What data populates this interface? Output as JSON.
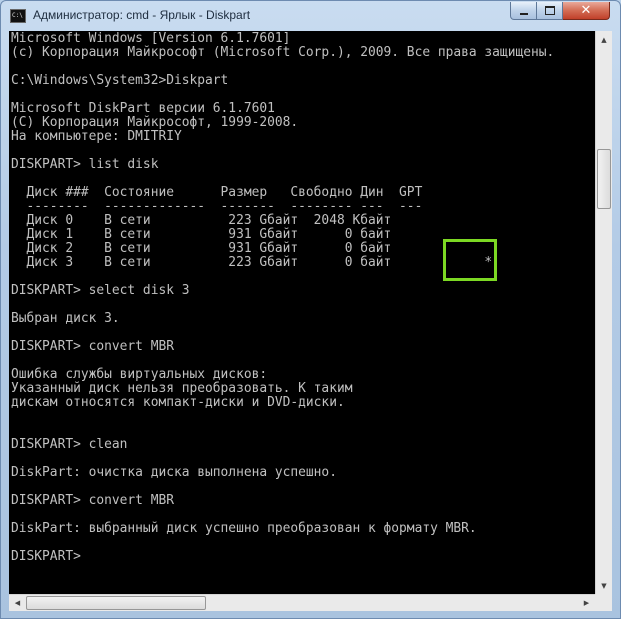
{
  "window": {
    "title": "Администратор: cmd - Ярлык - Diskpart",
    "icon_text": "C:\\",
    "controls": {
      "minimize": "minimize-icon",
      "maximize": "maximize-icon",
      "close": "close-icon"
    }
  },
  "console": {
    "lines": [
      "Microsoft Windows [Version 6.1.7601]",
      "(c) Корпорация Майкрософт (Microsoft Corp.), 2009. Все права защищены.",
      "",
      "C:\\Windows\\System32>Diskpart",
      "",
      "Microsoft DiskPart версии 6.1.7601",
      "(C) Корпорация Майкрософт, 1999-2008.",
      "На компьютере: DMITRIY",
      "",
      "DISKPART> list disk",
      "",
      "  Диск ###  Состояние      Размер   Свободно Дин  GPT",
      "  --------  -------------  -------  -------- ---  ---",
      "  Диск 0    В сети          223 Gбайт  2048 Kбайт",
      "  Диск 1    В сети          931 Gбайт      0 байт",
      "  Диск 2    В сети          931 Gбайт      0 байт",
      "  Диск 3    В сети          223 Gбайт      0 байт            *",
      "",
      "DISKPART> select disk 3",
      "",
      "Выбран диск 3.",
      "",
      "DISKPART> convert MBR",
      "",
      "Ошибка службы виртуальных дисков:",
      "Указанный диск нельзя преобразовать. К таким",
      "дискам относятся компакт-диски и DVD-диски.",
      "",
      "",
      "DISKPART> clean",
      "",
      "DiskPart: очистка диска выполнена успешно.",
      "",
      "DISKPART> convert MBR",
      "",
      "DiskPart: выбранный диск успешно преобразован к формату MBR.",
      "",
      "DISKPART>"
    ]
  },
  "scrollbars": {
    "up": "▲",
    "down": "▼",
    "left": "◀",
    "right": "▶"
  },
  "colors": {
    "console_bg": "#000000",
    "console_text": "#c0c0c0",
    "highlight": "#7cd823"
  }
}
